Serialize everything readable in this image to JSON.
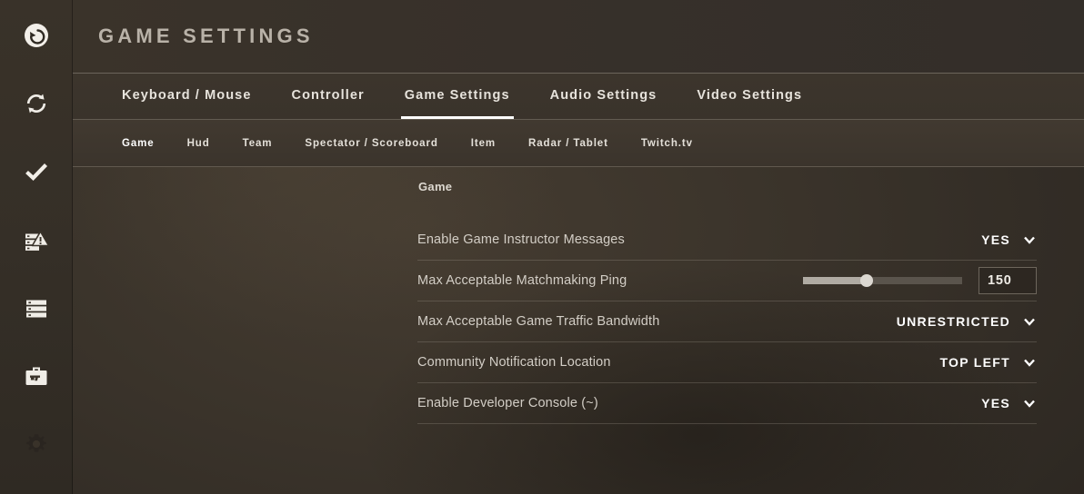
{
  "header": {
    "title": "GAME SETTINGS"
  },
  "sidebar": {
    "items": [
      {
        "name": "back-button",
        "icon": "back-circle-icon"
      },
      {
        "name": "refresh-button",
        "icon": "refresh-icon"
      },
      {
        "name": "accept-button",
        "icon": "checkmark-icon"
      },
      {
        "name": "server-alert-button",
        "icon": "server-warning-icon"
      },
      {
        "name": "server-list-button",
        "icon": "server-list-icon"
      },
      {
        "name": "inventory-button",
        "icon": "briefcase-gun-icon"
      },
      {
        "name": "settings-button",
        "icon": "gear-icon"
      }
    ]
  },
  "tabs": [
    {
      "label": "Keyboard / Mouse",
      "active": false
    },
    {
      "label": "Controller",
      "active": false
    },
    {
      "label": "Game Settings",
      "active": true
    },
    {
      "label": "Audio Settings",
      "active": false
    },
    {
      "label": "Video Settings",
      "active": false
    }
  ],
  "subtabs": [
    {
      "label": "Game",
      "active": true
    },
    {
      "label": "Hud",
      "active": false
    },
    {
      "label": "Team",
      "active": false
    },
    {
      "label": "Spectator / Scoreboard",
      "active": false
    },
    {
      "label": "Item",
      "active": false
    },
    {
      "label": "Radar / Tablet",
      "active": false
    },
    {
      "label": "Twitch.tv",
      "active": false
    }
  ],
  "settings": {
    "group_title": "Game",
    "rows": [
      {
        "label": "Enable Game Instructor Messages",
        "type": "dropdown",
        "value": "YES"
      },
      {
        "label": "Max Acceptable Matchmaking Ping",
        "type": "slider",
        "value": "150",
        "slider_percent": 40
      },
      {
        "label": "Max Acceptable Game Traffic Bandwidth",
        "type": "dropdown",
        "value": "UNRESTRICTED"
      },
      {
        "label": "Community Notification Location",
        "type": "dropdown",
        "value": "TOP LEFT"
      },
      {
        "label": "Enable Developer Console (~)",
        "type": "dropdown",
        "value": "YES"
      }
    ]
  },
  "colors": {
    "background": "#3b342b",
    "sidebar": "#393229",
    "accent": "#ffffff",
    "label_text": "#d3cec6",
    "value_text": "#ffffff",
    "title_text": "#b9b2a8",
    "slider_fill": "#b0aba3",
    "slider_track": "#5a544c"
  }
}
